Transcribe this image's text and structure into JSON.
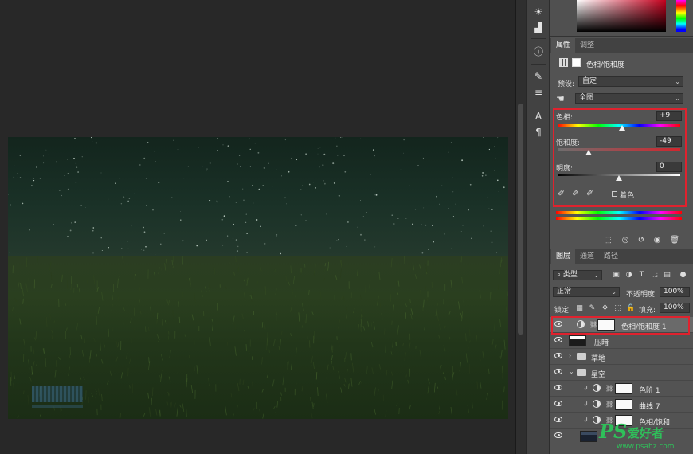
{
  "properties_panel": {
    "tabs": [
      {
        "label": "属性",
        "active": true
      },
      {
        "label": "调整",
        "active": false
      }
    ],
    "title": "色相/饱和度",
    "preset_label": "预设:",
    "preset_value": "自定",
    "channel_value": "全图",
    "hue": {
      "label": "色相:",
      "value": "+9",
      "level": 0.525
    },
    "saturation": {
      "label": "饱和度:",
      "value": "-49",
      "level": 0.255
    },
    "lightness": {
      "label": "明度:",
      "value": "0",
      "level": 0.5
    },
    "colorize_label": "着色"
  },
  "layers_panel": {
    "tabs": [
      {
        "label": "图层",
        "active": true
      },
      {
        "label": "通道",
        "active": false
      },
      {
        "label": "路径",
        "active": false
      }
    ],
    "filter_kind": "类型",
    "blend_mode": "正常",
    "opacity_label": "不透明度:",
    "opacity_value": "100%",
    "lock_label": "锁定:",
    "fill_label": "填充:",
    "fill_value": "100%",
    "layers": [
      {
        "name": "色相/饱和度 1",
        "type": "adjustment",
        "selected": true
      },
      {
        "name": "压暗",
        "type": "pixel"
      },
      {
        "name": "草地",
        "type": "group",
        "expanded": false
      },
      {
        "name": "星空",
        "type": "group",
        "expanded": true
      },
      {
        "name": "色阶 1",
        "type": "adjustment",
        "clipped": true
      },
      {
        "name": "曲线 7",
        "type": "adjustment",
        "clipped": true
      },
      {
        "name": "色相/饱和",
        "type": "adjustment",
        "clipped": true
      },
      {
        "name": "",
        "type": "pixel"
      }
    ]
  },
  "watermark": {
    "mark": "PS",
    "text": "爱好者",
    "url": "www.psahz.com"
  },
  "colors": {
    "highlight": "#e0222e",
    "panel_bg": "#535353",
    "watermark_green": "#2fbf5a"
  }
}
